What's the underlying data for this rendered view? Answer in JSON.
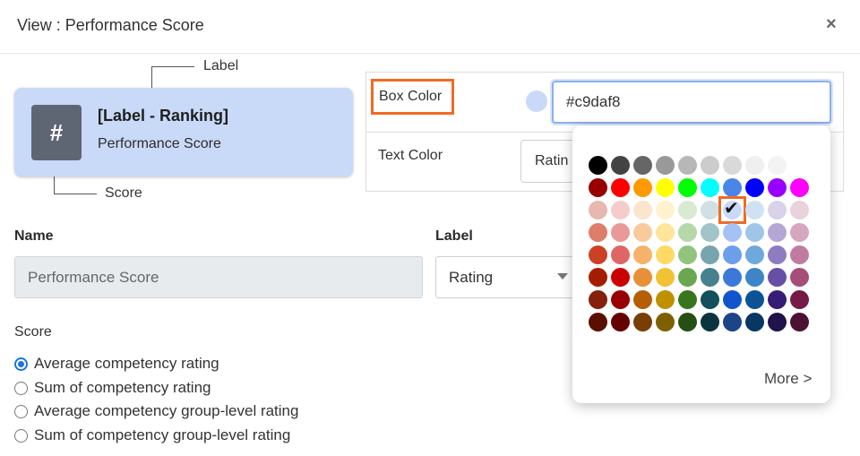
{
  "dialog": {
    "title": "View : Performance Score",
    "close_glyph": "×"
  },
  "annotations": {
    "label": "Label",
    "score": "Score"
  },
  "preview": {
    "icon_glyph": "#",
    "label": "[Label - Ranking]",
    "name": "Performance Score",
    "background": "#c9daf8"
  },
  "box_color": {
    "label": "Box Color",
    "value": "#c9daf8"
  },
  "text_color": {
    "label": "Text Color",
    "select_value": "Ratin"
  },
  "name_field": {
    "label": "Name",
    "value": "Performance Score"
  },
  "label_field": {
    "label": "Label",
    "value": "Rating"
  },
  "score": {
    "title": "Score",
    "options": [
      {
        "label": "Average competency rating",
        "selected": true
      },
      {
        "label": "Sum of competency rating",
        "selected": false
      },
      {
        "label": "Average competency group-level rating",
        "selected": false
      },
      {
        "label": "Sum of competency group-level rating",
        "selected": false
      }
    ]
  },
  "palette": {
    "more_label": "More >",
    "selected": "#c9daf8",
    "rows": [
      [
        "#000000",
        "#434343",
        "#666666",
        "#999999",
        "#b7b7b7",
        "#cccccc",
        "#d9d9d9",
        "#efefef",
        "#f3f3f3"
      ],
      [
        "#980000",
        "#ff0000",
        "#ff9900",
        "#ffff00",
        "#00ff00",
        "#00ffff",
        "#4a86e8",
        "#0000ff",
        "#9900ff",
        "#ff00ff"
      ],
      [
        "#e6b8af",
        "#f4cccc",
        "#fce5cd",
        "#fff2cc",
        "#d9ead3",
        "#d0e0e3",
        "#c9daf8",
        "#cfe2f3",
        "#d9d2e9",
        "#ead1dc"
      ],
      [
        "#dd7e6b",
        "#ea9999",
        "#f9cb9c",
        "#ffe599",
        "#b6d7a8",
        "#a2c4c9",
        "#a4c2f4",
        "#9fc5e8",
        "#b4a7d6",
        "#d5a6bd"
      ],
      [
        "#cc4125",
        "#e06666",
        "#f6b26b",
        "#ffd966",
        "#93c47d",
        "#76a5af",
        "#6d9eeb",
        "#6fa8dc",
        "#8e7cc3",
        "#c27ba0"
      ],
      [
        "#a61c00",
        "#cc0000",
        "#e69138",
        "#f1c232",
        "#6aa84f",
        "#45818e",
        "#3c78d8",
        "#3d85c6",
        "#674ea7",
        "#a64d79"
      ],
      [
        "#85200c",
        "#990000",
        "#b45f06",
        "#bf9000",
        "#38761d",
        "#134f5c",
        "#1155cc",
        "#0b5394",
        "#351c75",
        "#741b47"
      ],
      [
        "#5b0f00",
        "#660000",
        "#783f04",
        "#7f6000",
        "#274e13",
        "#0c343d",
        "#1c4587",
        "#073763",
        "#20124d",
        "#4c1130"
      ]
    ]
  }
}
